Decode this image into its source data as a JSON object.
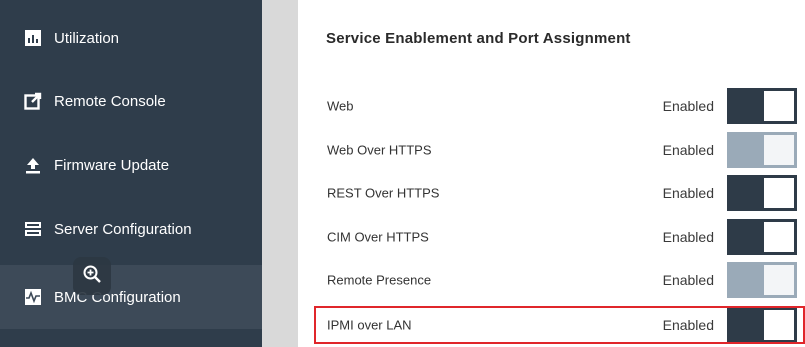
{
  "sidebar": {
    "items": [
      {
        "label": "Utilization",
        "icon": "bar-chart-icon"
      },
      {
        "label": "Remote Console",
        "icon": "external-link-icon"
      },
      {
        "label": "Firmware Update",
        "icon": "upload-icon"
      },
      {
        "label": "Server Configuration",
        "icon": "server-icon"
      },
      {
        "label": "BMC Configuration",
        "icon": "pulse-icon",
        "active": true
      }
    ]
  },
  "panel": {
    "title": "Service Enablement and Port Assignment",
    "rows": [
      {
        "label": "Web",
        "status": "Enabled",
        "toggle_style": "dark"
      },
      {
        "label": "Web Over HTTPS",
        "status": "Enabled",
        "toggle_style": "light"
      },
      {
        "label": "REST Over HTTPS",
        "status": "Enabled",
        "toggle_style": "dark"
      },
      {
        "label": "CIM Over HTTPS",
        "status": "Enabled",
        "toggle_style": "dark"
      },
      {
        "label": "Remote Presence",
        "status": "Enabled",
        "toggle_style": "light"
      },
      {
        "label": "IPMI over LAN",
        "status": "Enabled",
        "toggle_style": "dark",
        "highlighted": true
      }
    ]
  },
  "colors": {
    "sidebar_bg": "#2f3d4b",
    "toggle_dark": "#2e3b48",
    "toggle_light": "#9aaab8",
    "highlight": "#e0262b"
  }
}
